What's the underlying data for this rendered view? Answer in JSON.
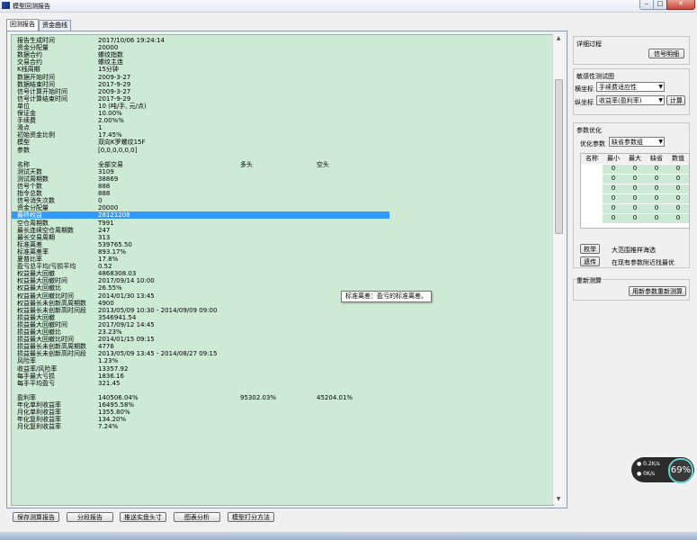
{
  "window": {
    "title": "模型回测报告",
    "min_icon": "–",
    "max_icon": "□",
    "close_icon": "✕"
  },
  "tabs": [
    {
      "label": "回测报告"
    },
    {
      "label": "资金曲线"
    }
  ],
  "report": {
    "rows": [
      {
        "k": "报告生成时间",
        "v": "2017/10/06 19:24:14"
      },
      {
        "k": "资金分配量",
        "v": "20000"
      },
      {
        "k": "数据合约",
        "v": "螺纹指数"
      },
      {
        "k": "交易合约",
        "v": "螺纹主连"
      },
      {
        "k": "K线周期",
        "v": "15分钟"
      },
      {
        "k": "数据开始时间",
        "v": "2009-3-27"
      },
      {
        "k": "数据结束时间",
        "v": "2017-9-29"
      },
      {
        "k": "信号计算开始时间",
        "v": "2009-3-27"
      },
      {
        "k": "信号计算结束时间",
        "v": "2017-9-29"
      },
      {
        "k": "单位",
        "v": "10 (吨/手, 元/点)"
      },
      {
        "k": "保证金",
        "v": "10.00%"
      },
      {
        "k": "手续费",
        "v": "2.00%%"
      },
      {
        "k": "滑点",
        "v": "1"
      },
      {
        "k": "初始资金比例",
        "v": "17.45%"
      },
      {
        "k": "模型",
        "v": "双向K罗螺纹15F"
      },
      {
        "k": "参数",
        "v": "[0,0,0,0,0,0]"
      },
      {
        "k": "",
        "v": ""
      },
      {
        "k": "名称",
        "v": "全部交易",
        "c3": "多头",
        "c4": "空头"
      },
      {
        "k": "测试天数",
        "v": "3109"
      },
      {
        "k": "测试周期数",
        "v": "38869"
      },
      {
        "k": "信号个数",
        "v": "888"
      },
      {
        "k": "指令总数",
        "v": "888"
      },
      {
        "k": "信号消失次数",
        "v": "0"
      },
      {
        "k": "资金分配量",
        "v": "20000"
      },
      {
        "k": "最终权益",
        "v": "28121208",
        "hl": true
      },
      {
        "k": "空仓周期数",
        "v": "T991"
      },
      {
        "k": "最长连续空仓周期数",
        "v": "247"
      },
      {
        "k": "最长交易周期",
        "v": "313"
      },
      {
        "k": "标准离差",
        "v": "539765.50"
      },
      {
        "k": "标准离差率",
        "v": "893.17%"
      },
      {
        "k": "夏普比率",
        "v": "17.8%"
      },
      {
        "k": "盈亏总平均/亏损平均",
        "v": "0.52"
      },
      {
        "k": "权益最大回撤",
        "v": "4868308.03"
      },
      {
        "k": "权益最大回撤时间",
        "v": "2017/09/14 10:00"
      },
      {
        "k": "权益最大回撤比",
        "v": "26.55%"
      },
      {
        "k": "权益最大回撤比时间",
        "v": "2014/01/30 13:45"
      },
      {
        "k": "权益最长未创新高周期数",
        "v": "4900"
      },
      {
        "k": "权益最长未创新高时间段",
        "v": "2013/05/09 10:30 - 2014/09/09 09:00"
      },
      {
        "k": "损益最大回撤",
        "v": "3546941.54"
      },
      {
        "k": "损益最大回撤时间",
        "v": "2017/09/12 14:45"
      },
      {
        "k": "损益最大回撤比",
        "v": "23.23%"
      },
      {
        "k": "损益最大回撤比时间",
        "v": "2014/01/15 09:15"
      },
      {
        "k": "损益最长未创新高周期数",
        "v": "4776"
      },
      {
        "k": "损益最长未创新高时间段",
        "v": "2013/05/09 13:45 - 2014/08/27 09:15"
      },
      {
        "k": "风险率",
        "v": "1.23%"
      },
      {
        "k": "收益率/风险率",
        "v": "13357.92"
      },
      {
        "k": "每手最大亏损",
        "v": "1836.16"
      },
      {
        "k": "每手平均盈亏",
        "v": "321.45"
      },
      {
        "k": "",
        "v": ""
      },
      {
        "k": "盈利率",
        "v": "140506.04%",
        "c3": "95302.03%",
        "c4": "45204.01%"
      },
      {
        "k": "年化单利收益率",
        "v": "16495.58%"
      },
      {
        "k": "月化单利收益率",
        "v": "1355.80%"
      },
      {
        "k": "年化复利收益率",
        "v": "134.20%"
      },
      {
        "k": "月化复利收益率",
        "v": "7.24%"
      }
    ],
    "tooltip": "标准离差：盈亏的标准离差。"
  },
  "side": {
    "detail": {
      "title": "详细过程",
      "button": "信号明细"
    },
    "sensitivity": {
      "title": "敏感性测试图",
      "x_label": "横坐标",
      "x_value": "手续费适应性",
      "y_label": "纵坐标",
      "y_value": "收益率(盈利率)",
      "calc_button": "计算"
    },
    "param": {
      "title": "参数优化",
      "opt_label": "优化参数",
      "opt_value": "缺省参数组",
      "headers": [
        "名称",
        "最小",
        "最大",
        "缺省",
        "数值"
      ],
      "rows": [
        [
          "",
          "0",
          "0",
          "0",
          "0"
        ],
        [
          "",
          "0",
          "0",
          "0",
          "0"
        ],
        [
          "",
          "0",
          "0",
          "0",
          "0"
        ],
        [
          "",
          "0",
          "0",
          "0",
          "0"
        ],
        [
          "",
          "0",
          "0",
          "0",
          "0"
        ],
        [
          "",
          "0",
          "0",
          "0",
          "0"
        ]
      ],
      "exhaust_button": "枚举",
      "exhaust_text": "大范围推样海选",
      "genetic_button": "遗传",
      "genetic_text": "在现有参数附近找最优"
    },
    "recalc": {
      "title": "重新测算",
      "button": "用新参数重新测算"
    }
  },
  "bottom_buttons": [
    "保存测算报告",
    "分段报告",
    "推送实盘头寸",
    "图表分析",
    "模型打分方法"
  ],
  "widget": {
    "up": "0.2K/s",
    "down": "0K/s",
    "percent": "69%"
  }
}
